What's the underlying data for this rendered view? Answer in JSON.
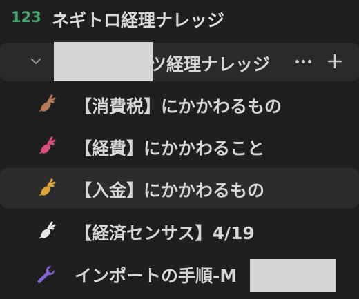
{
  "header": {
    "icon_text": "123",
    "title": "ネギトロ経理ナレッジ"
  },
  "group": {
    "title_visible": "ツ経理ナレッジ",
    "more_label": "more options",
    "add_label": "add"
  },
  "items": [
    {
      "label": "【消費税】にかかわるもの",
      "icon": "carrot-icon",
      "icon_color": "#b87a5a"
    },
    {
      "label": "【経費】にかかわること",
      "icon": "carrot-icon",
      "icon_color": "#d94f7a"
    },
    {
      "label": "【入金】にかかわるもの",
      "icon": "carrot-icon",
      "icon_color": "#e0a23a"
    },
    {
      "label": "【経済センサス】4/19",
      "icon": "carrot-icon",
      "icon_color": "#e6e6e6"
    },
    {
      "label": "インポートの手順-M",
      "icon": "wrench-icon",
      "icon_color": "#8a62d6"
    }
  ],
  "colors": {
    "background": "#1f1f1f",
    "accent_green": "#44a56e",
    "selected_row": "#2c2c2c"
  }
}
